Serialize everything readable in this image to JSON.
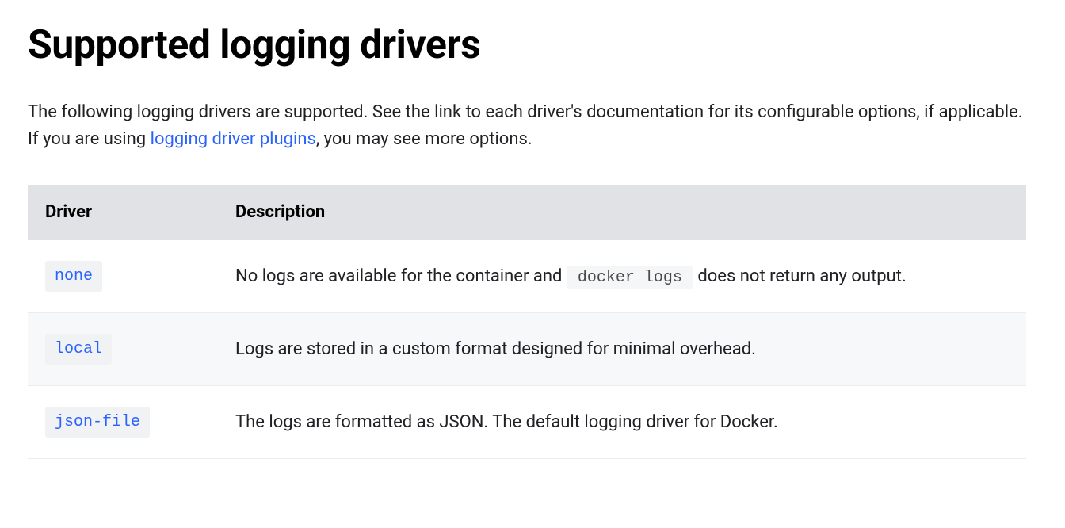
{
  "heading": "Supported logging drivers",
  "intro": {
    "part1": "The following logging drivers are supported. See the link to each driver's documentation for its configurable options, if applicable. If you are using ",
    "link_text": "logging driver plugins",
    "part2": ", you may see more options."
  },
  "table": {
    "headers": {
      "driver": "Driver",
      "description": "Description"
    },
    "rows": [
      {
        "driver": "none",
        "desc_pre": "No logs are available for the container and ",
        "desc_code": "docker logs",
        "desc_post": " does not return any output."
      },
      {
        "driver": "local",
        "desc_pre": "Logs are stored in a custom format designed for minimal overhead.",
        "desc_code": "",
        "desc_post": ""
      },
      {
        "driver": "json-file",
        "desc_pre": "The logs are formatted as JSON. The default logging driver for Docker.",
        "desc_code": "",
        "desc_post": ""
      }
    ]
  }
}
